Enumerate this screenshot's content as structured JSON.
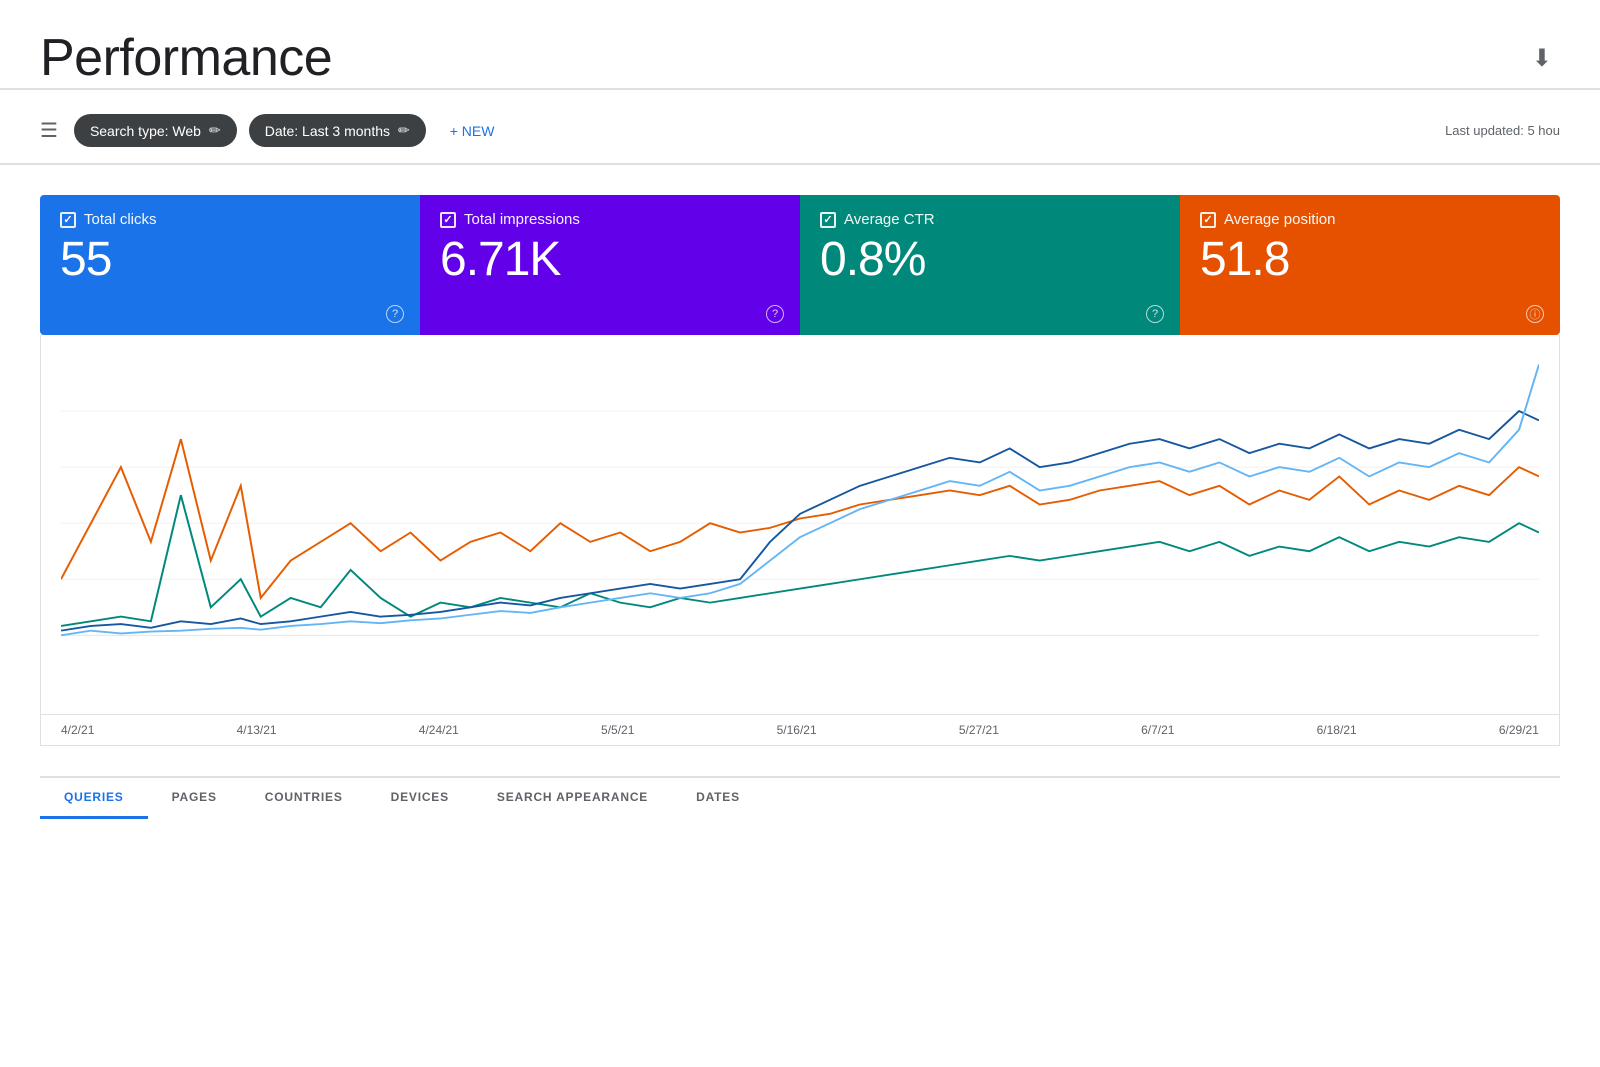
{
  "page": {
    "title": "Performance",
    "last_updated": "Last updated: 5 hou",
    "download_icon": "⬇"
  },
  "filters": {
    "filter_icon": "☰",
    "chips": [
      {
        "label": "Search type: Web",
        "edit": "✏"
      },
      {
        "label": "Date: Last 3 months",
        "edit": "✏"
      }
    ],
    "new_button": "+ NEW"
  },
  "metrics": [
    {
      "id": "total-clicks",
      "label": "Total clicks",
      "value": "55",
      "color": "blue"
    },
    {
      "id": "total-impressions",
      "label": "Total impressions",
      "value": "6.71K",
      "color": "purple"
    },
    {
      "id": "average-ctr",
      "label": "Average CTR",
      "value": "0.8%",
      "color": "teal"
    },
    {
      "id": "average-position",
      "label": "Average position",
      "value": "51.8",
      "color": "orange"
    }
  ],
  "chart": {
    "date_labels": [
      "4/2/21",
      "4/13/21",
      "4/24/21",
      "5/5/21",
      "5/16/21",
      "5/27/21",
      "6/7/21",
      "6/18/21",
      "6/29/21"
    ],
    "colors": {
      "blue_dark": "#1557a0",
      "orange": "#e65c00",
      "teal": "#00897b",
      "blue_light": "#64b5f6"
    }
  },
  "bottom_tabs": {
    "tabs": [
      "QUERIES",
      "PAGES",
      "COUNTRIES",
      "DEVICES",
      "SEARCH APPEARANCE",
      "DATES"
    ]
  }
}
